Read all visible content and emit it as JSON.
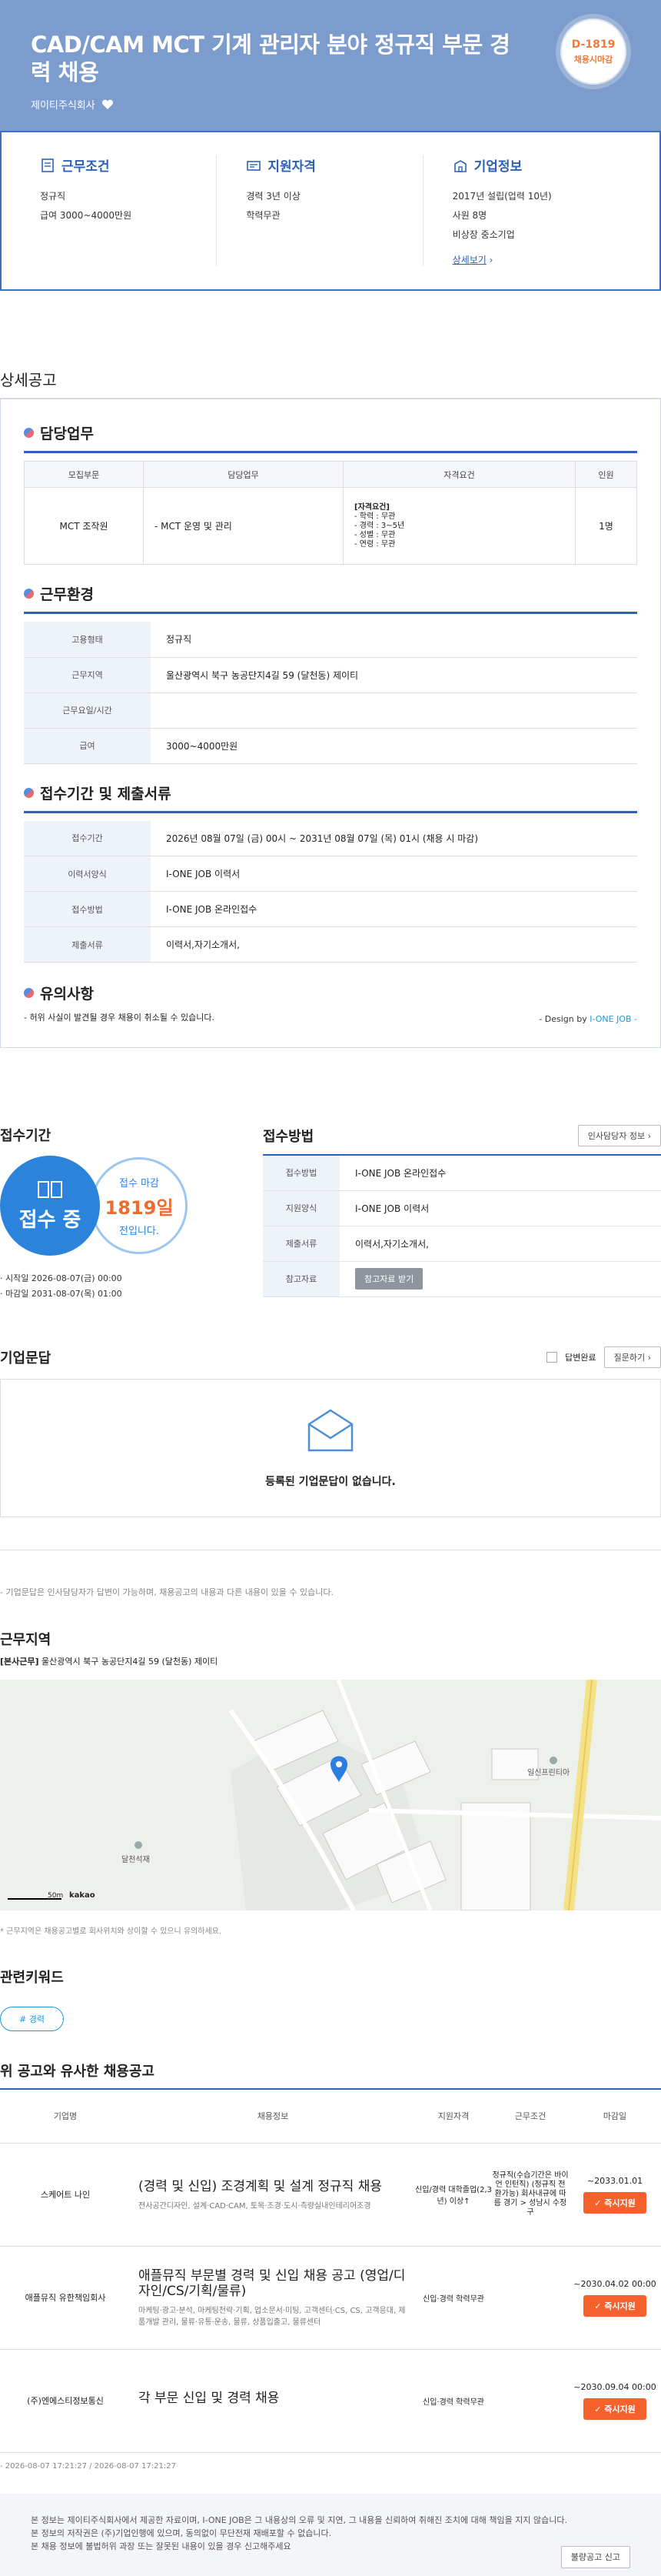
{
  "header": {
    "title": "CAD/CAM MCT 기계 관리자 분야 정규직 부문 경력 채용",
    "company": "제이티주식회사",
    "dday": "D-1819",
    "dday_sub": "채용시마감"
  },
  "summary": {
    "work": {
      "title": "근무조건",
      "lines": [
        "정규직",
        "급여 3000~4000만원"
      ]
    },
    "qual": {
      "title": "지원자격",
      "lines": [
        "경력 3년 이상",
        "학력무관"
      ]
    },
    "company": {
      "title": "기업정보",
      "lines": [
        "2017년 설립(업력 10년)",
        "사원 8명",
        "비상장 중소기업"
      ],
      "more": "상세보기"
    }
  },
  "detail": {
    "section_title": "상세공고",
    "duty": {
      "title": "담당업무",
      "headers": [
        "모집부문",
        "담당업무",
        "자격요건",
        "인원"
      ],
      "row": {
        "part": "MCT 조작원",
        "task": "- MCT 운영 및 관리",
        "req_title": "[자격요건]",
        "req_lines": [
          "- 학력 : 무관",
          "- 경력 : 3~5년",
          "- 성별 : 무관",
          "- 연령 : 무관"
        ],
        "count": "1명"
      }
    },
    "env": {
      "title": "근무환경",
      "rows": [
        {
          "k": "고용형태",
          "v": "정규직"
        },
        {
          "k": "근무지역",
          "v": "울산광역시 북구 농공단지4길 59 (달천동) 제이티"
        },
        {
          "k": "근무요일/시간",
          "v": ""
        },
        {
          "k": "급여",
          "v": "3000~4000만원"
        }
      ]
    },
    "period": {
      "title": "접수기간 및 제출서류",
      "rows": [
        {
          "k": "접수기간",
          "v": "2026년 08월 07일 (금) 00시 ~ 2031년 08월 07일 (목) 01시 (채용 시 마감)"
        },
        {
          "k": "이력서양식",
          "v": "I-ONE JOB 이력서"
        },
        {
          "k": "접수방법",
          "v": "I-ONE JOB 온라인접수"
        },
        {
          "k": "제출서류",
          "v": "이력서,자기소개서,"
        }
      ]
    },
    "notice": {
      "title": "유의사항",
      "text": "- 허위 사실이 발견될 경우 채용이 취소될 수 있습니다."
    },
    "design_prefix": "- Design by ",
    "design_brand": "I-ONE JOB -"
  },
  "receipt": {
    "left_title": "접수기간",
    "status": "접수 중",
    "deadline_label": "접수 마감",
    "deadline_days": "1819일",
    "deadline_suffix": "전입니다.",
    "start": "· 시작일 2026-08-07(금) 00:00",
    "end": "· 마감일 2031-08-07(목) 01:00",
    "right_title": "접수방법",
    "contact_btn": "인사담당자 정보 ›",
    "rows": [
      {
        "k": "접수방법",
        "v": "I-ONE JOB 온라인접수"
      },
      {
        "k": "지원양식",
        "v": "I-ONE JOB 이력서"
      },
      {
        "k": "제출서류",
        "v": "이력서,자기소개서,"
      },
      {
        "k": "참고자료",
        "v": "참고자료 받기"
      }
    ]
  },
  "qa": {
    "title": "기업문답",
    "answered_label": "답변완료",
    "ask_btn": "질문하기 ›",
    "empty": "등록된 기업문답이 없습니다.",
    "note": "- 기업문답은 인사담당자가 답변이 가능하며, 채용공고의 내용과 다른 내용이 있을 수 있습니다."
  },
  "location": {
    "title": "근무지역",
    "addr_tag": "[본사근무]",
    "addr": "울산광역시 북구 농공단지4길 59 (달천동) 제이티",
    "label_a": "일신프린티아",
    "label_b": "달천석재",
    "scale": "50m",
    "brand": "kakao",
    "note": "* 근무지역은 채용공고별로 회사위치와 상이할 수 있으니 유의하세요."
  },
  "keywords": {
    "title": "관련키워드",
    "items": [
      "# 경력"
    ]
  },
  "similar": {
    "title": "위 공고와 유사한 채용공고",
    "headers": [
      "기업명",
      "채용정보",
      "지원자격",
      "근무조건",
      "마감일"
    ],
    "rows": [
      {
        "company": "스케어트 나인",
        "title": "(경력 및 신입) 조경계획 및 설계 정규직 채용",
        "desc": "전사공간디자인, 설계·CAD·CAM, 토목·조경·도시·측량실내인테리어조경",
        "qual": "신입/경력 대학졸업(2,3년) 이상↑",
        "cond": "정규직(수습기간은 바이언 인턴직) (정규직 전환가능) 회사내규에 따름 경기 > 성남시 수정구",
        "due": "~2033.01.01",
        "apply": "즉시지원"
      },
      {
        "company": "애플뮤직 유한책임회사",
        "title": "애플뮤직 부문별 경력 및 신입 채용 공고 (영업/디자인/CS/기획/물류)",
        "desc": "마케팅·광고·분석, 마케팅전략·기획, 업소문서·미팅, 고객센터·CS, CS, 고객응대, 제품개발 관리, 물류·유통·운송, 물류, 상품입출고, 물류센터",
        "qual": "신입·경력 학력무관",
        "cond": "",
        "due": "~2030.04.02 00:00",
        "apply": "즉시지원"
      },
      {
        "company": "(주)엔에스티정보통신",
        "title": "각 부문 신입 및 경력 채용",
        "desc": "",
        "qual": "신입·경력 학력무관",
        "cond": "",
        "due": "~2030.09.04 00:00",
        "apply": "즉시지원"
      }
    ]
  },
  "dates": "- 2026-08-07 17:21:27 / 2026-08-07 17:21:27",
  "footer": {
    "lines": [
      "본 정보는 제이티주식회사에서 제공한 자료이며, I-ONE JOB은 그 내용상의 오류 및 지연, 그 내용을 신뢰하여 취해진 조치에 대해 책임을 지지 않습니다.",
      "본 정보의 저작권은 (주)기업인행에 있으며, 동의없이 무단전재 재배포할 수 없습니다.",
      "본 채용 정보에 불법허위 과장 또는 잘못된 내용이 있을 경우 신고해주세요"
    ],
    "report": "불량공고 신고"
  }
}
